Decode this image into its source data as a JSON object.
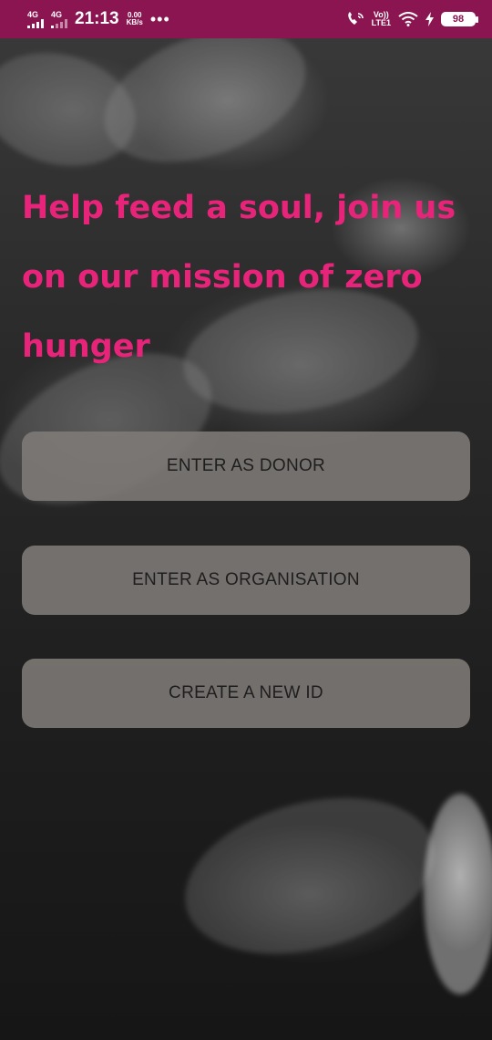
{
  "status_bar": {
    "net1": "4G",
    "net2": "4G",
    "time": "21:13",
    "speed_value": "0.00",
    "speed_unit": "KB/s",
    "more": "•••",
    "volte_top": "Vo))",
    "volte_bottom": "LTE1",
    "battery": "98",
    "bar_color": "#8a1550"
  },
  "headline": {
    "text": "Help feed a soul, join us on our mission of zero hunger",
    "color": "#e8247a"
  },
  "buttons": {
    "donor": "ENTER AS DONOR",
    "organisation": "ENTER AS ORGANISATION",
    "new_id": "CREATE A NEW ID"
  }
}
